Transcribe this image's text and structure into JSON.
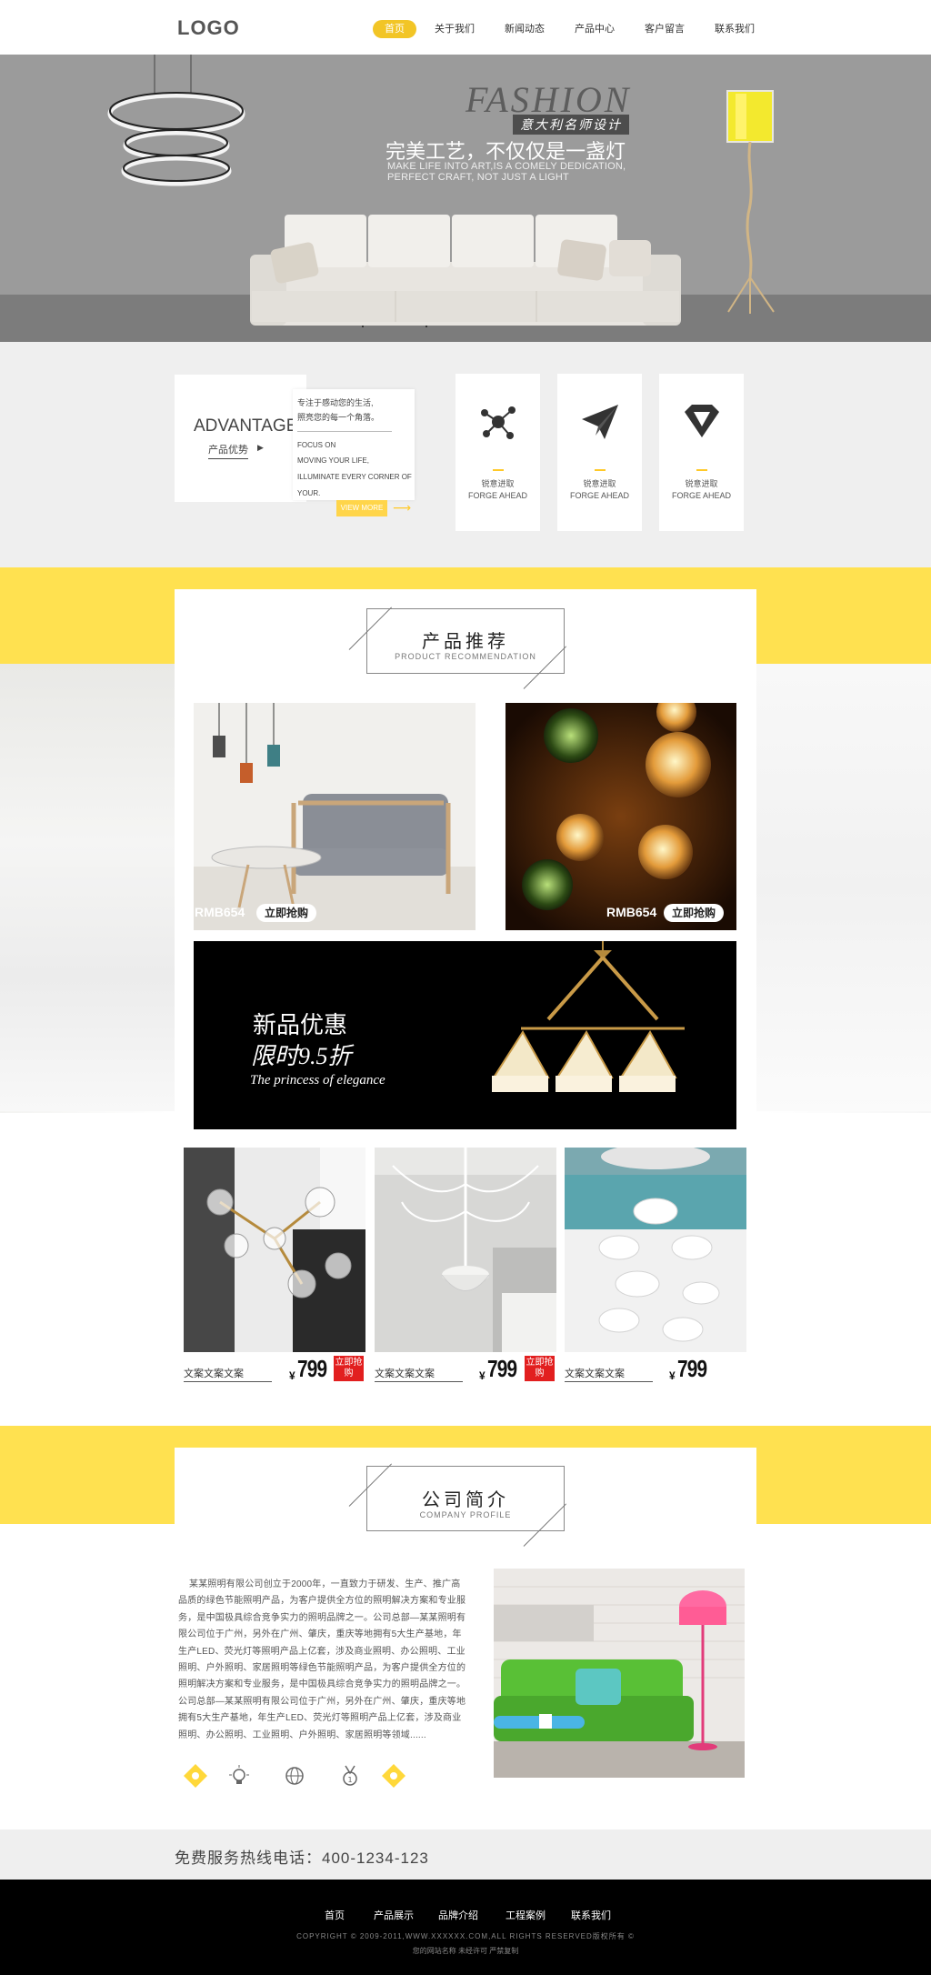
{
  "header": {
    "logo": "LOGO",
    "nav": [
      "首页",
      "关于我们",
      "新闻动态",
      "产品中心",
      "客户留言",
      "联系我们"
    ],
    "active_index": 0
  },
  "hero": {
    "fashion": "FASHION",
    "badge": "意大利名师设计",
    "title": "完美工艺，不仅仅是一盏灯",
    "sub_line1": "MAKE LIFE INTO ART,IS A COMELY DEDICATION,",
    "sub_line2": "PERFECT CRAFT, NOT JUST A LIGHT"
  },
  "advantage": {
    "title": "ADVANTAGE",
    "subtitle": "产品优势",
    "desc_cn_1": "专注于感动您的生活,",
    "desc_cn_2": "照亮您的每一个角落。",
    "desc_en_1": "FOCUS ON",
    "desc_en_2": "MOVING YOUR LIFE,",
    "desc_en_3": "ILLUMINATE EVERY CORNER OF",
    "desc_en_4": "YOUR.",
    "more": "VIEW MORE",
    "cards": [
      {
        "cn": "锐意进取",
        "en": "FORGE AHEAD",
        "icon": "molecule-icon"
      },
      {
        "cn": "锐意进取",
        "en": "FORGE AHEAD",
        "icon": "paper-plane-icon"
      },
      {
        "cn": "锐意进取",
        "en": "FORGE AHEAD",
        "icon": "diamond-icon"
      }
    ]
  },
  "products": {
    "heading_cn": "产品推荐",
    "heading_en": "PRODUCT  RECOMMENDATION",
    "large": [
      {
        "price": "RMB654",
        "buy": "立即抢购"
      },
      {
        "price": "RMB654",
        "buy": "立即抢购"
      }
    ],
    "promo": {
      "line1": "新品优惠",
      "line2": "限时9.5折",
      "line3": "The princess of elegance"
    },
    "small": [
      {
        "caption": "文案文案文案",
        "currency": "¥",
        "price": "799",
        "buy": "立即抢购"
      },
      {
        "caption": "文案文案文案",
        "currency": "¥",
        "price": "799",
        "buy": "立即抢购"
      },
      {
        "caption": "文案文案文案",
        "currency": "¥",
        "price": "799"
      }
    ]
  },
  "company": {
    "heading_cn": "公司简介",
    "heading_en": "COMPANY PROFILE",
    "text": "某某照明有限公司创立于2000年，一直致力于研发、生产、推广高品质的绿色节能照明产品，为客户提供全方位的照明解决方案和专业服务，是中国极具综合竞争实力的照明品牌之一。公司总部—某某照明有限公司位于广州，另外在广州、肇庆，重庆等地拥有5大生产基地，年生产LED、荧光灯等照明产品上亿套，涉及商业照明、办公照明、工业照明、户外照明、家居照明等绿色节能照明产品，为客户提供全方位的照明解决方案和专业服务，是中国极具综合竞争实力的照明品牌之一。公司总部—某某照明有限公司位于广州，另外在广州、肇庆，重庆等地拥有5大生产基地，年生产LED、荧光灯等照明产品上亿套，涉及商业照明、办公照明、工业照明、户外照明、家居照明等领域......"
  },
  "hotline": "免费服务热线电话：400-1234-123",
  "footer": {
    "links": [
      "首页",
      "产品展示",
      "品牌介绍",
      "工程案例",
      "联系我们"
    ],
    "copyright": "COPYRIGHT © 2009-2011,WWW.XXXXXX.COM,ALL RIGHTS RESERVED版权所有 ©",
    "icp": "您的网站名称 未经许可 严禁复制"
  },
  "colors": {
    "accent": "#ffe150",
    "nav_active": "#f2c526",
    "buy_red": "#e21f1f"
  }
}
